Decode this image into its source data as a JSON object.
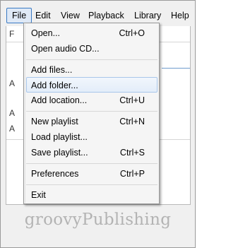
{
  "menubar": {
    "items": [
      {
        "label": "File",
        "active": true
      },
      {
        "label": "Edit"
      },
      {
        "label": "View"
      },
      {
        "label": "Playback"
      },
      {
        "label": "Library"
      },
      {
        "label": "Help"
      }
    ]
  },
  "app_body_fragments": [
    "F",
    "A",
    "A",
    "A"
  ],
  "file_menu": {
    "groups": [
      [
        {
          "label": "Open...",
          "shortcut": "Ctrl+O"
        },
        {
          "label": "Open audio CD...",
          "shortcut": ""
        }
      ],
      [
        {
          "label": "Add files...",
          "shortcut": ""
        },
        {
          "label": "Add folder...",
          "shortcut": "",
          "highlighted": true
        },
        {
          "label": "Add location...",
          "shortcut": "Ctrl+U"
        }
      ],
      [
        {
          "label": "New playlist",
          "shortcut": "Ctrl+N"
        },
        {
          "label": "Load playlist...",
          "shortcut": ""
        },
        {
          "label": "Save playlist...",
          "shortcut": "Ctrl+S"
        }
      ],
      [
        {
          "label": "Preferences",
          "shortcut": "Ctrl+P"
        }
      ],
      [
        {
          "label": "Exit",
          "shortcut": ""
        }
      ]
    ]
  },
  "watermark": "groovyPublishing",
  "colors": {
    "menu_active_border": "#3a7ac4",
    "menu_active_bg": "#dfe9f6",
    "hover_border": "#a8c6ea",
    "watermark": "#b3b3b3"
  }
}
